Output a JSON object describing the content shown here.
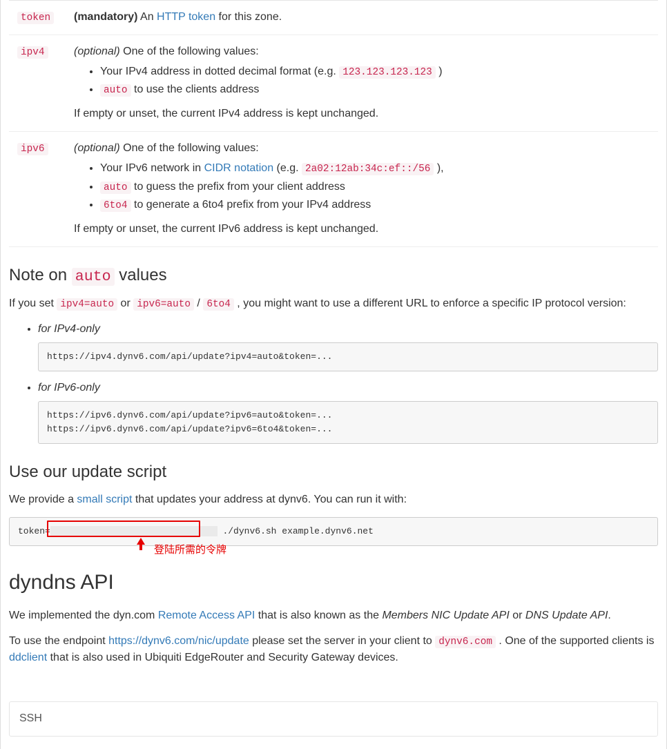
{
  "params": {
    "token": {
      "key": "token",
      "mandatory_label": "(mandatory)",
      "text_before_link": " An ",
      "link": "HTTP token",
      "text_after_link": " for this zone."
    },
    "ipv4": {
      "key": "ipv4",
      "optional_label": "(optional)",
      "lead": " One of the following values:",
      "bullet1": "Your IPv4 address in dotted decimal format (e.g. ",
      "bullet1_code": "123.123.123.123",
      "bullet1_after": " )",
      "bullet2_code": "auto",
      "bullet2_after": " to use the clients address",
      "empty_note": "If empty or unset, the current IPv4 address is kept unchanged."
    },
    "ipv6": {
      "key": "ipv6",
      "optional_label": "(optional)",
      "lead": " One of the following values:",
      "bullet1_before": "Your IPv6 network in ",
      "bullet1_link": "CIDR notation",
      "bullet1_mid": " (e.g. ",
      "bullet1_code": "2a02:12ab:34c:ef::/56",
      "bullet1_after": " ),",
      "bullet2_code": "auto",
      "bullet2_after": " to guess the prefix from your client address",
      "bullet3_code": "6to4",
      "bullet3_after": " to generate a 6to4 prefix from your IPv4 address",
      "empty_note": "If empty or unset, the current IPv6 address is kept unchanged."
    }
  },
  "note": {
    "heading_prefix": "Note on ",
    "heading_code": "auto",
    "heading_suffix": " values",
    "sentence_parts": {
      "p1": "If you set ",
      "c1": "ipv4=auto",
      "p2": " or ",
      "c2": "ipv6=auto",
      "slash": " / ",
      "c3": "6to4",
      "p3": " , you might want to use a different URL to enforce a specific IP protocol version:"
    },
    "ipv4_label": "for IPv4-only",
    "ipv4_code": "https://ipv4.dynv6.com/api/update?ipv4=auto&token=...",
    "ipv6_label": "for IPv6-only",
    "ipv6_code": "https://ipv6.dynv6.com/api/update?ipv6=auto&token=...\nhttps://ipv6.dynv6.com/api/update?ipv6=6to4&token=..."
  },
  "update_script": {
    "heading": "Use our update script",
    "sentence_parts": {
      "p1": "We provide a ",
      "link": "small script",
      "p2": " that updates your address at dynv6. You can run it with:"
    },
    "code_prefix": "token=",
    "code_token_masked": "                               ",
    "code_suffix": " ./dynv6.sh example.dynv6.net"
  },
  "annotation": {
    "label": "登陆所需的令牌"
  },
  "dyndns": {
    "heading": "dyndns API",
    "p1": {
      "a": "We implemented the dyn.com ",
      "link": "Remote Access API",
      "b": " that is also known as the ",
      "i1": "Members NIC Update API",
      "c": " or ",
      "i2": "DNS Update API",
      "d": "."
    },
    "p2": {
      "a": "To use the endpoint ",
      "link1": "https://dynv6.com/nic/update",
      "b": " please set the server in your client to ",
      "code": "dynv6.com",
      "c": " . One of the supported clients is ",
      "link2": "ddclient",
      "d": " that is also used in Ubiquiti EdgeRouter and Security Gateway devices."
    }
  },
  "ssh": {
    "title": "SSH"
  }
}
